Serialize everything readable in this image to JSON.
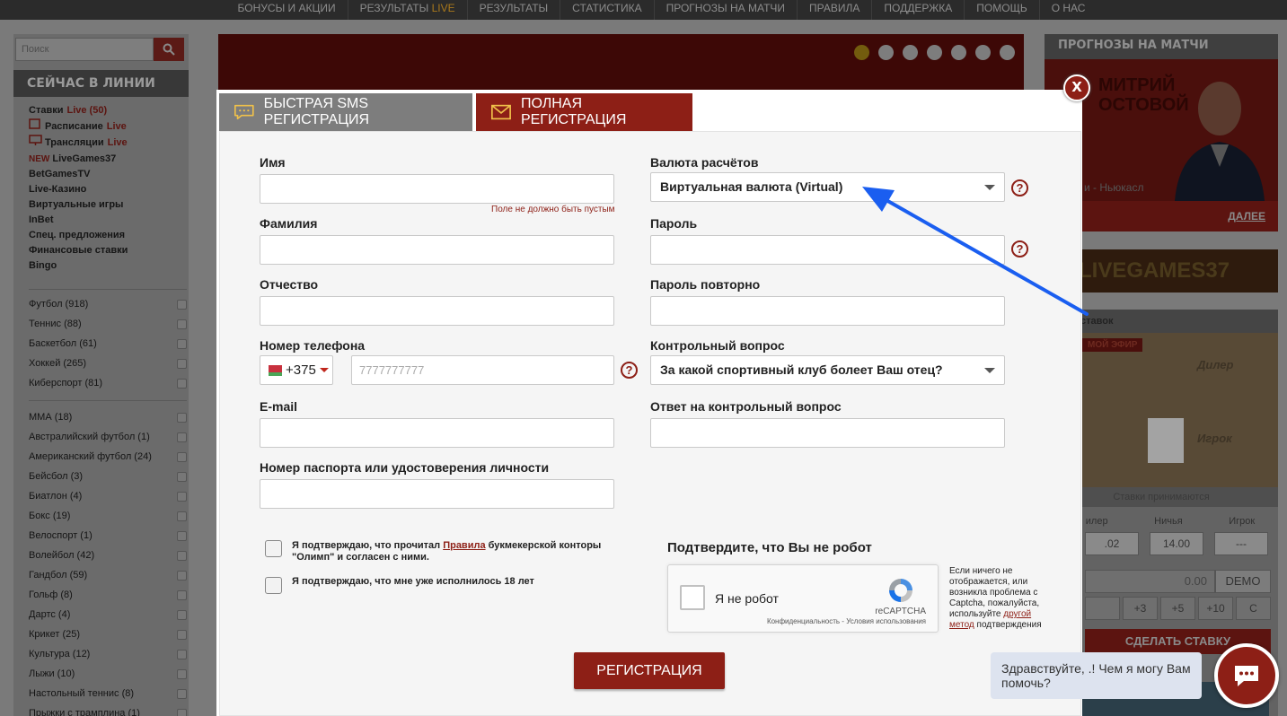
{
  "topnav": {
    "items": [
      "БОНУСЫ И АКЦИИ",
      "РЕЗУЛЬТАТЫ",
      "РЕЗУЛЬТАТЫ",
      "СТАТИСТИКА",
      "ПРОГНОЗЫ НА МАТЧИ",
      "ПРАВИЛА",
      "ПОДДЕРЖКА",
      "ПОМОЩЬ",
      "О НАС"
    ],
    "live_suffix": "LIVE"
  },
  "sidebar": {
    "search_placeholder": "Поиск",
    "heading": "СЕЙЧАС В ЛИНИИ",
    "links": [
      {
        "label": "Ставки",
        "suffix": "Live (50)"
      },
      {
        "label": "Расписание",
        "suffix": "Live"
      },
      {
        "label": "Трансляции",
        "suffix": "Live"
      },
      {
        "label": "LiveGames37",
        "prefix": "NEW"
      },
      {
        "label": "BetGamesTV"
      },
      {
        "label": "Live-Казино"
      },
      {
        "label": "Виртуальные игры"
      },
      {
        "label": "InBet"
      },
      {
        "label": "Спец. предложения"
      },
      {
        "label": "Финансовые ставки"
      },
      {
        "label": "Bingo"
      }
    ],
    "sports_main": [
      "Футбол (918)",
      "Теннис (88)",
      "Баскетбол (61)",
      "Хоккей (265)",
      "Киберспорт (81)"
    ],
    "sports_other": [
      "ММА (18)",
      "Австралийский футбол (1)",
      "Американский футбол (24)",
      "Бейсбол (3)",
      "Биатлон (4)",
      "Бокс (19)",
      "Велоспорт (1)",
      "Волейбол (42)",
      "Гандбол (59)",
      "Гольф (8)",
      "Дартс (4)",
      "Крикет (25)",
      "Культура (12)",
      "Лыжи (10)",
      "Настольный теннис (8)",
      "Прыжки с трамплина (1)"
    ]
  },
  "right_column": {
    "heading": "ПРОГНОЗЫ НА МАТЧИ",
    "promo_name": "МИТРИЙ\nОСТОВОЙ",
    "match_caption": "и - Ньюкасл",
    "more": "ДАЛЕЕ",
    "livegames": "LIVEGAMES37",
    "bet_header": "ставок",
    "live_badge": "МОЙ ЭФИР",
    "dealer": "Дилер",
    "player": "Игрок",
    "accepting": "Ставки принимаются",
    "labels": [
      "илер",
      "Ничья",
      "Игрок"
    ],
    "odds": [
      ".02",
      "14.00",
      "---"
    ],
    "stake": "0.00",
    "demo": "DEMO",
    "quick": [
      "",
      "+3",
      "+5",
      "+10",
      "C"
    ],
    "make_bet": "СДЕЛАТЬ СТАВКУ"
  },
  "modal": {
    "tab_sms": "БЫСТРАЯ SMS РЕГИСТРАЦИЯ",
    "tab_full": "ПОЛНАЯ РЕГИСТРАЦИЯ",
    "close": "X",
    "fields": {
      "first_name": "Имя",
      "first_name_error": "Поле не должно быть пустым",
      "last_name": "Фамилия",
      "patronymic": "Отчество",
      "phone": "Номер телефона",
      "phone_code": "+375",
      "phone_placeholder": "7777777777",
      "email": "E-mail",
      "passport": "Номер паспорта или удостоверения личности",
      "currency": "Валюта расчётов",
      "currency_value": "Виртуальная валюта (Virtual)",
      "password": "Пароль",
      "password_repeat": "Пароль повторно",
      "security_question": "Контрольный вопрос",
      "security_question_value": "За какой спортивный клуб болеет Ваш отец?",
      "security_answer": "Ответ на контрольный вопрос"
    },
    "consent_rules_pre": "Я подтверждаю, что прочитал ",
    "consent_rules_link": "Правила",
    "consent_rules_post": " букмекерской конторы \"Олимп\" и согласен с ними.",
    "consent_age": "Я подтверждаю, что мне уже исполнилось 18 лет",
    "robot_title": "Подтвердите, что Вы не робот",
    "captcha_label": "Я не робот",
    "captcha_brand": "reCAPTCHA",
    "captcha_privacy": "Конфиденциальность - Условия использования",
    "captcha_note_pre": "Если ничего не отображается, или возникла проблема с Captcha, пожалуйста, используйте ",
    "captcha_note_link": "другой метод",
    "captcha_note_post": " подтверждения",
    "submit": "РЕГИСТРАЦИЯ"
  },
  "chat": {
    "message": "Здравствуйте, .! Чем я могу Вам помочь?"
  },
  "colors": {
    "brand_red": "#8d1f16",
    "arrow_blue": "#1a5ef0"
  }
}
